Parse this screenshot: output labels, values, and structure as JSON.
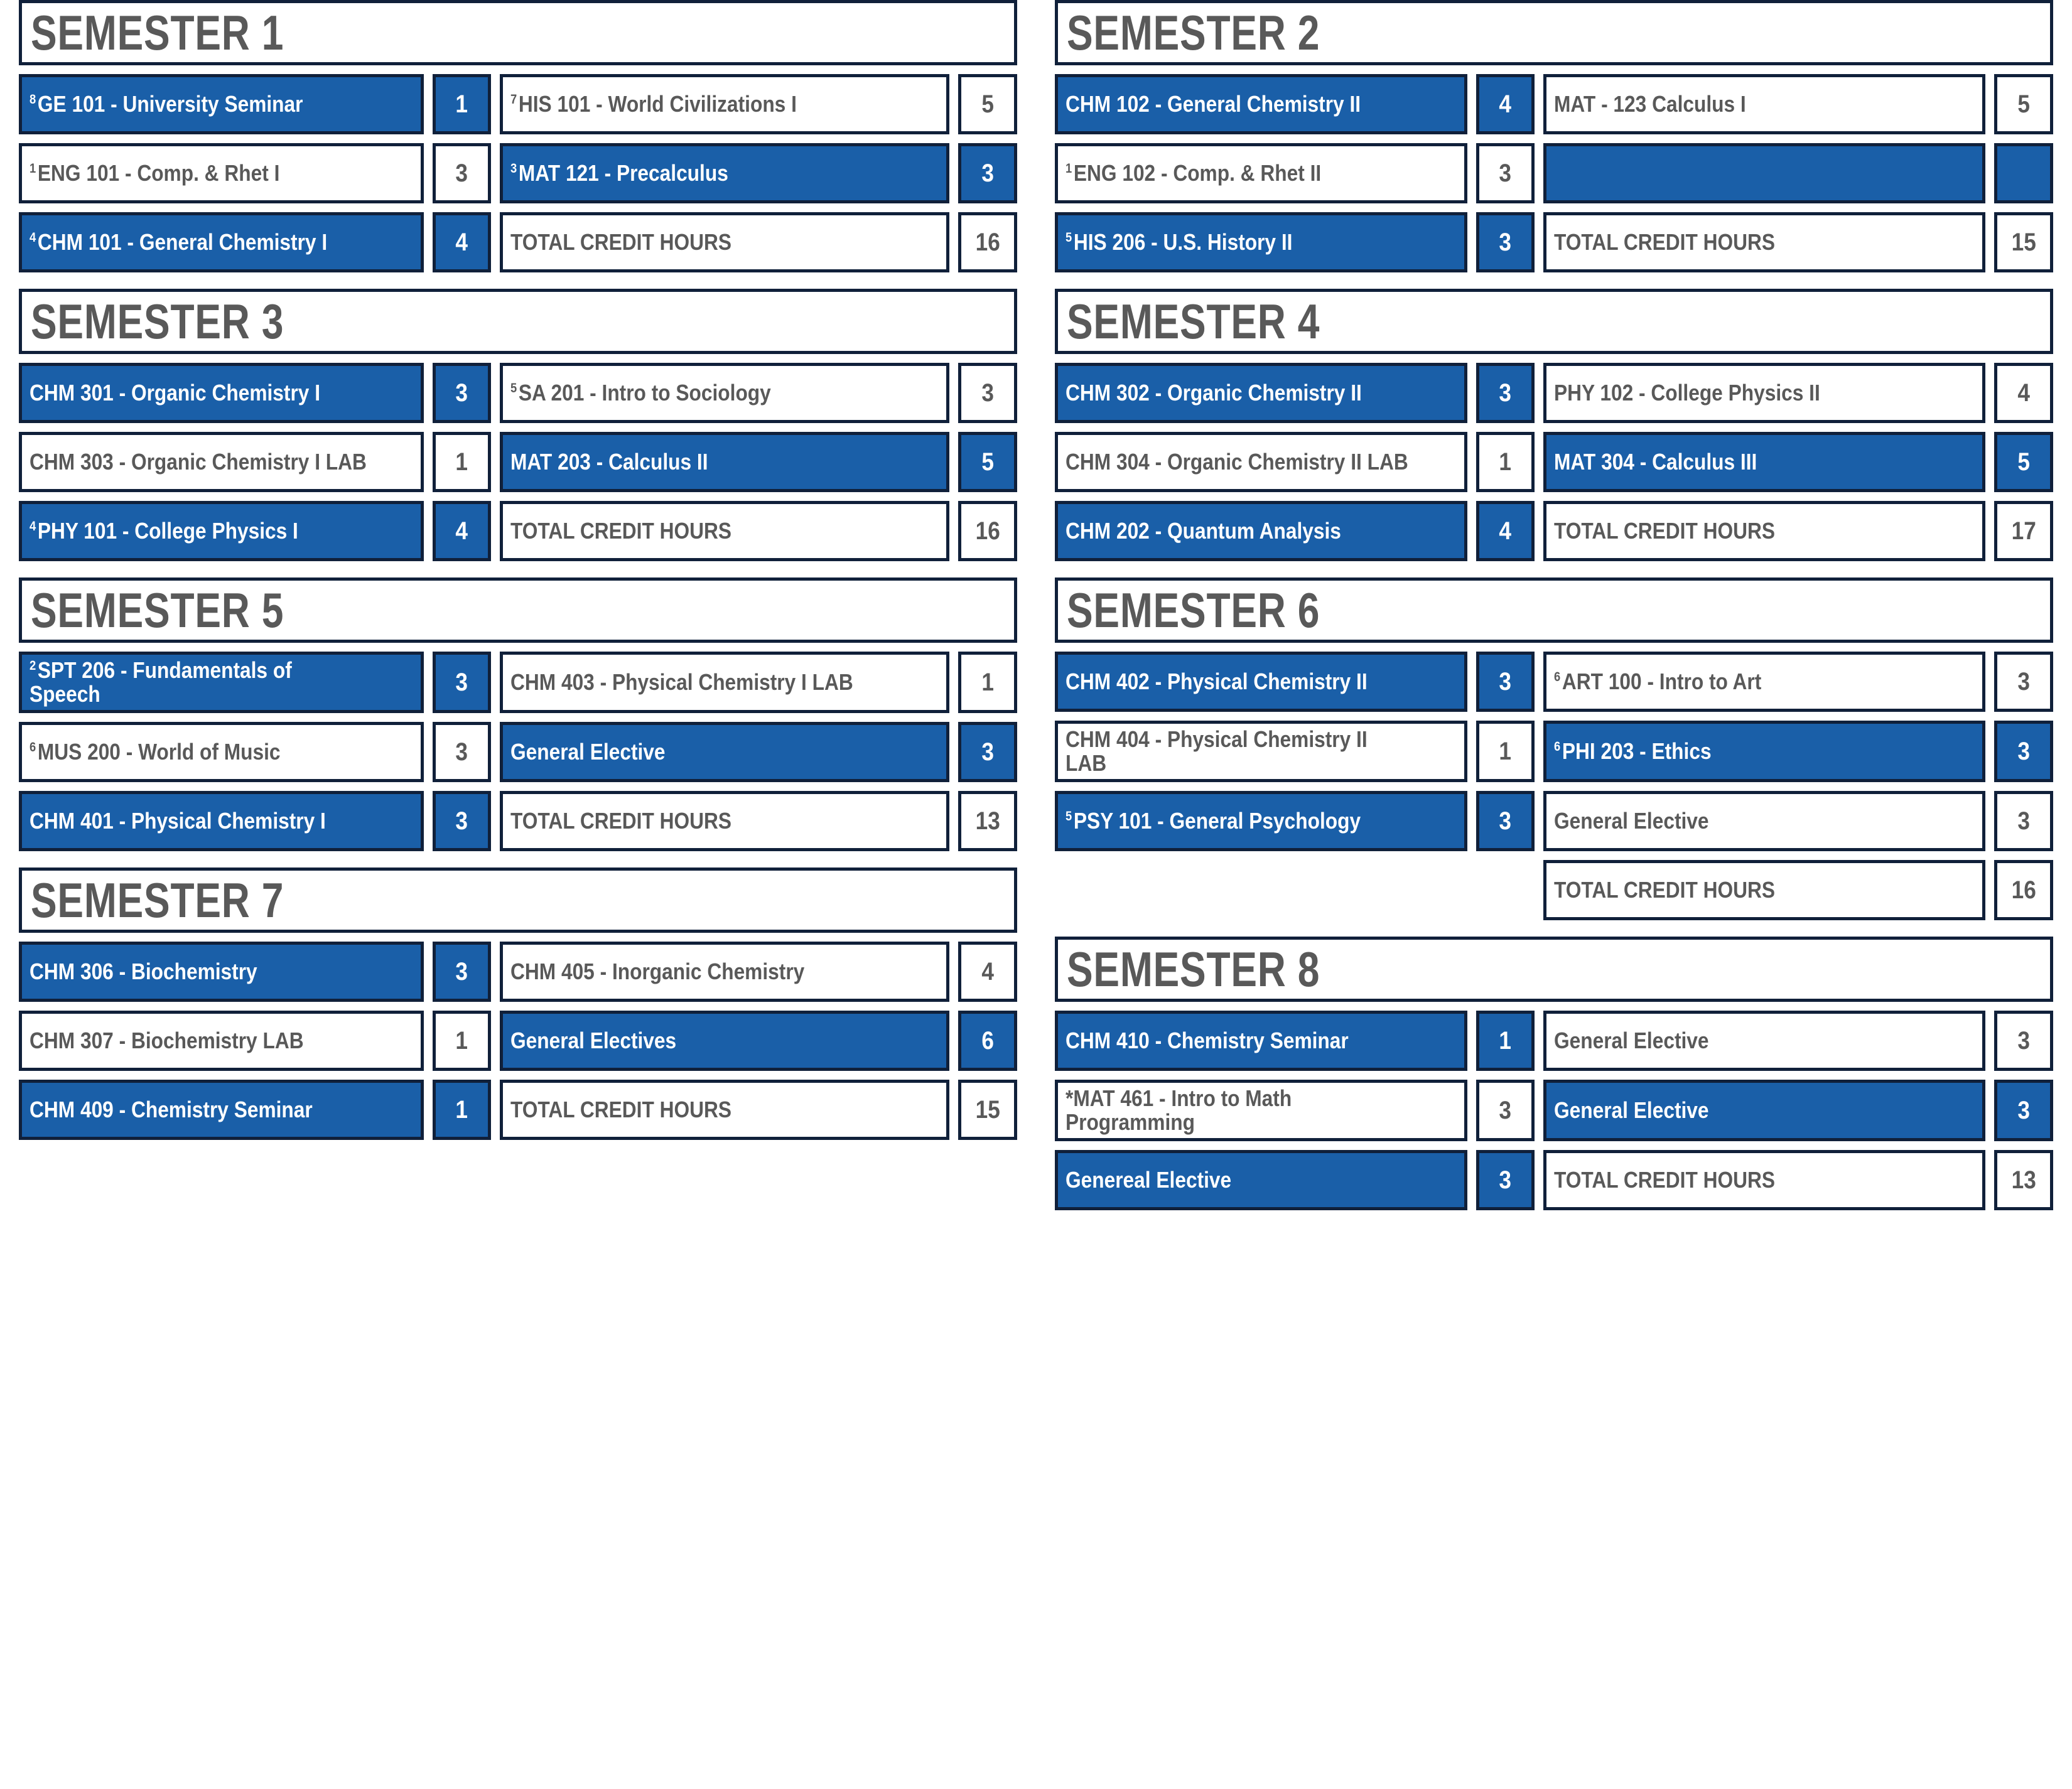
{
  "theme": {
    "accent_blue": "#1a5fa8",
    "border_navy": "#10203a",
    "text_gray": "#595959",
    "text_on_blue": "#ffffff",
    "background": "#ffffff"
  },
  "labels": {
    "total_credit_hours": "TOTAL CREDIT HOURS"
  },
  "semesters": [
    {
      "id": "semester-1",
      "title": "SEMESTER 1",
      "side": "left",
      "rows": [
        {
          "left": {
            "sup": "8",
            "name": "GE 101 - University Seminar",
            "credits": "1",
            "blue": true
          },
          "right": {
            "sup": "7",
            "name": "HIS 101 - World Civilizations I",
            "credits": "5",
            "blue": false
          }
        },
        {
          "left": {
            "sup": "1",
            "name": "ENG 101 - Comp. & Rhet I",
            "credits": "3",
            "blue": false
          },
          "right": {
            "sup": "3",
            "name": "MAT 121 - Precalculus",
            "credits": "3",
            "blue": true
          }
        },
        {
          "left": {
            "sup": "4",
            "name": "CHM 101 - General Chemistry I",
            "credits": "4",
            "blue": true
          },
          "right": {
            "sup": "",
            "name": "TOTAL CREDIT HOURS",
            "credits": "16",
            "blue": false,
            "total": true
          }
        }
      ]
    },
    {
      "id": "semester-2",
      "title": "SEMESTER 2",
      "side": "right",
      "rows": [
        {
          "left": {
            "sup": "",
            "name": "CHM 102 - General Chemistry II",
            "credits": "4",
            "blue": true
          },
          "right": {
            "sup": "",
            "name": "MAT - 123 Calculus I",
            "credits": "5",
            "blue": false
          }
        },
        {
          "left": {
            "sup": "1",
            "name": "ENG 102 - Comp. & Rhet II",
            "credits": "3",
            "blue": false
          },
          "right": {
            "sup": "",
            "name": "",
            "credits": "",
            "blue": true,
            "empty": true
          }
        },
        {
          "left": {
            "sup": "5",
            "name": "HIS 206 - U.S. History II",
            "credits": "3",
            "blue": true
          },
          "right": {
            "sup": "",
            "name": "TOTAL CREDIT HOURS",
            "credits": "15",
            "blue": false,
            "total": true
          }
        }
      ]
    },
    {
      "id": "semester-3",
      "title": "SEMESTER 3",
      "side": "left",
      "rows": [
        {
          "left": {
            "sup": "",
            "name": "CHM 301 - Organic Chemistry I",
            "credits": "3",
            "blue": true
          },
          "right": {
            "sup": "5",
            "name": "SA 201 - Intro to Sociology",
            "credits": "3",
            "blue": false
          }
        },
        {
          "left": {
            "sup": "",
            "name": "CHM 303 - Organic Chemistry I LAB",
            "credits": "1",
            "blue": false
          },
          "right": {
            "sup": "",
            "name": "MAT 203 - Calculus II",
            "credits": "5",
            "blue": true
          }
        },
        {
          "left": {
            "sup": "4",
            "name": "PHY 101 - College Physics I",
            "credits": "4",
            "blue": true
          },
          "right": {
            "sup": "",
            "name": "TOTAL CREDIT HOURS",
            "credits": "16",
            "blue": false,
            "total": true
          }
        }
      ]
    },
    {
      "id": "semester-4",
      "title": "SEMESTER 4",
      "side": "right",
      "rows": [
        {
          "left": {
            "sup": "",
            "name": "CHM 302 - Organic Chemistry II",
            "credits": "3",
            "blue": true
          },
          "right": {
            "sup": "",
            "name": "PHY 102 - College Physics II",
            "credits": "4",
            "blue": false
          }
        },
        {
          "left": {
            "sup": "",
            "name": "CHM 304 - Organic Chemistry II LAB",
            "credits": "1",
            "blue": false
          },
          "right": {
            "sup": "",
            "name": "MAT 304 - Calculus III",
            "credits": "5",
            "blue": true
          }
        },
        {
          "left": {
            "sup": "",
            "name": "CHM 202 - Quantum Analysis",
            "credits": "4",
            "blue": true
          },
          "right": {
            "sup": "",
            "name": "TOTAL CREDIT HOURS",
            "credits": "17",
            "blue": false,
            "total": true
          }
        }
      ]
    },
    {
      "id": "semester-5",
      "title": "SEMESTER 5",
      "side": "left",
      "rows": [
        {
          "left": {
            "sup": "2",
            "name": "SPT 206 - Fundamentals of Speech",
            "credits": "3",
            "blue": true
          },
          "right": {
            "sup": "",
            "name": "CHM 403 - Physical Chemistry I LAB",
            "credits": "1",
            "blue": false
          }
        },
        {
          "left": {
            "sup": "6",
            "name": "MUS 200 - World of Music",
            "credits": "3",
            "blue": false
          },
          "right": {
            "sup": "",
            "name": "General Elective",
            "credits": "3",
            "blue": true
          }
        },
        {
          "left": {
            "sup": "",
            "name": "CHM 401 - Physical Chemistry I",
            "credits": "3",
            "blue": true
          },
          "right": {
            "sup": "",
            "name": "TOTAL CREDIT HOURS",
            "credits": "13",
            "blue": false,
            "total": true
          }
        }
      ]
    },
    {
      "id": "semester-6",
      "title": "SEMESTER 6",
      "side": "right",
      "rows": [
        {
          "left": {
            "sup": "",
            "name": "CHM 402 - Physical Chemistry II",
            "credits": "3",
            "blue": true
          },
          "right": {
            "sup": "6",
            "name": "ART 100 - Intro to Art",
            "credits": "3",
            "blue": false
          }
        },
        {
          "left": {
            "sup": "",
            "name": "CHM 404 - Physical Chemistry II LAB",
            "credits": "1",
            "blue": false
          },
          "right": {
            "sup": "6",
            "name": "PHI 203 - Ethics",
            "credits": "3",
            "blue": true
          }
        },
        {
          "left": {
            "sup": "5",
            "name": "PSY 101 - General Psychology",
            "credits": "3",
            "blue": true
          },
          "right": {
            "sup": "",
            "name": "General Elective",
            "credits": "3",
            "blue": false
          }
        },
        {
          "left": null,
          "right": {
            "sup": "",
            "name": "TOTAL CREDIT HOURS",
            "credits": "16",
            "blue": false,
            "total": true
          }
        }
      ]
    },
    {
      "id": "semester-7",
      "title": "SEMESTER 7",
      "side": "left",
      "rows": [
        {
          "left": {
            "sup": "",
            "name": "CHM 306 - Biochemistry",
            "credits": "3",
            "blue": true
          },
          "right": {
            "sup": "",
            "name": "CHM 405 - Inorganic Chemistry",
            "credits": "4",
            "blue": false
          }
        },
        {
          "left": {
            "sup": "",
            "name": "CHM 307 - Biochemistry LAB",
            "credits": "1",
            "blue": false
          },
          "right": {
            "sup": "",
            "name": "General Electives",
            "credits": "6",
            "blue": true
          }
        },
        {
          "left": {
            "sup": "",
            "name": "CHM 409 - Chemistry Seminar",
            "credits": "1",
            "blue": true
          },
          "right": {
            "sup": "",
            "name": "TOTAL CREDIT HOURS",
            "credits": "15",
            "blue": false,
            "total": true
          }
        }
      ]
    },
    {
      "id": "semester-8",
      "title": "SEMESTER 8",
      "side": "right",
      "rows": [
        {
          "left": {
            "sup": "",
            "name": "CHM 410 - Chemistry Seminar",
            "credits": "1",
            "blue": true
          },
          "right": {
            "sup": "",
            "name": "General Elective",
            "credits": "3",
            "blue": false
          }
        },
        {
          "left": {
            "sup": "",
            "name": "*MAT 461 - Intro to Math Programming",
            "credits": "3",
            "blue": false
          },
          "right": {
            "sup": "",
            "name": "General Elective",
            "credits": "3",
            "blue": true
          }
        },
        {
          "left": {
            "sup": "",
            "name": "Genereal Elective",
            "credits": "3",
            "blue": true
          },
          "right": {
            "sup": "",
            "name": "TOTAL CREDIT HOURS",
            "credits": "13",
            "blue": false,
            "total": true
          }
        }
      ]
    }
  ]
}
